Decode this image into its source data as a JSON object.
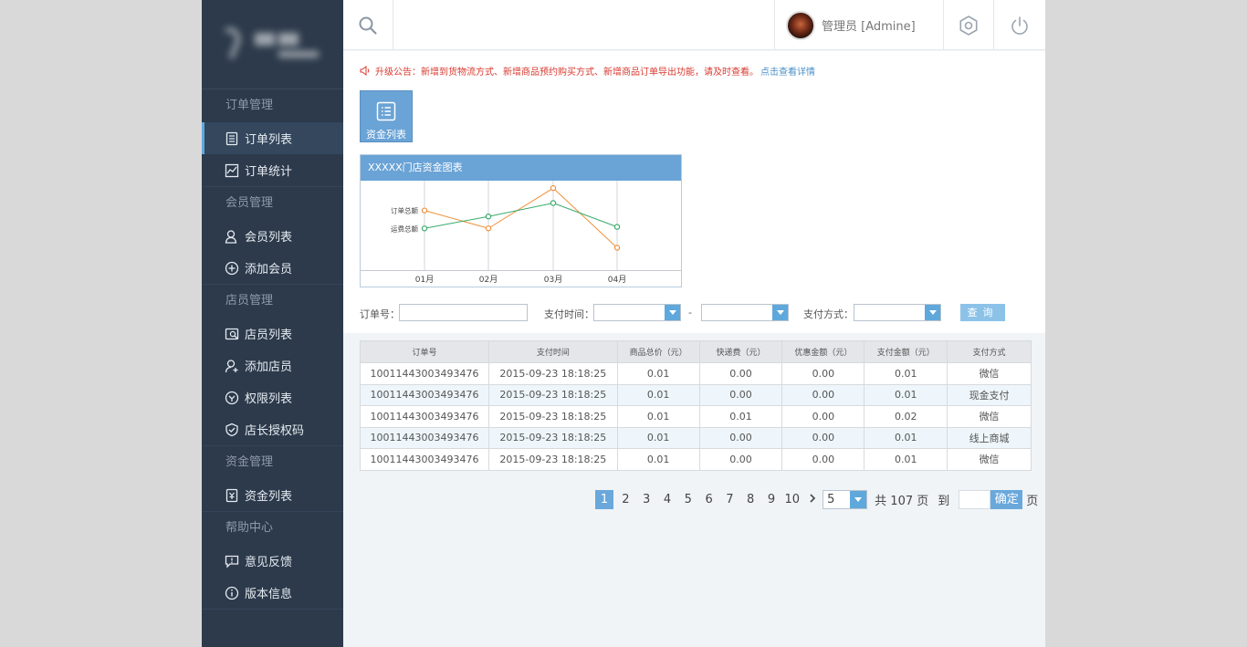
{
  "sidebar": {
    "sections": [
      {
        "title": "订单管理",
        "items": [
          "订单列表",
          "订单统计"
        ]
      },
      {
        "title": "会员管理",
        "items": [
          "会员列表",
          "添加会员"
        ]
      },
      {
        "title": "店员管理",
        "items": [
          "店员列表",
          "添加店员",
          "权限列表",
          "店长授权码"
        ]
      },
      {
        "title": "资金管理",
        "items": [
          "资金列表"
        ]
      },
      {
        "title": "帮助中心",
        "items": [
          "意见反馈",
          "版本信息"
        ]
      }
    ],
    "active_item": "订单列表"
  },
  "header": {
    "user": "管理员 [Admine]"
  },
  "notice": {
    "text": "升级公告：新增到货物流方式、新增商品预约购买方式、新增商品订单导出功能，请及时查看。",
    "link": "点击查看详情"
  },
  "tile": {
    "label": "资金列表"
  },
  "chart_data": {
    "type": "line",
    "title": "XXXXX门店资金图表",
    "categories": [
      "01月",
      "02月",
      "03月",
      "04月"
    ],
    "series": [
      {
        "name": "订单总额",
        "color": "#f0903a",
        "values": [
          40,
          28,
          55,
          15
        ]
      },
      {
        "name": "运费总额",
        "color": "#3aaa6a",
        "values": [
          28,
          36,
          45,
          29
        ]
      }
    ],
    "grid": true
  },
  "filters": {
    "order_no_label": "订单号：",
    "order_no_value": "",
    "pay_time_label": "支付时间：",
    "range_sep": "-",
    "pay_method_label": "支付方式：",
    "query_label": "查询"
  },
  "table": {
    "headers": [
      "订单号",
      "支付时间",
      "商品总价（元）",
      "快递费（元）",
      "优惠金额（元）",
      "支付金额（元）",
      "支付方式"
    ],
    "rows": [
      [
        "10011443003493476",
        "2015-09-23 18:18:25",
        "0.01",
        "0.00",
        "0.00",
        "0.01",
        "微信"
      ],
      [
        "10011443003493476",
        "2015-09-23 18:18:25",
        "0.01",
        "0.00",
        "0.00",
        "0.01",
        "现金支付"
      ],
      [
        "10011443003493476",
        "2015-09-23 18:18:25",
        "0.01",
        "0.01",
        "0.00",
        "0.02",
        "微信"
      ],
      [
        "10011443003493476",
        "2015-09-23 18:18:25",
        "0.01",
        "0.00",
        "0.00",
        "0.01",
        "线上商城"
      ],
      [
        "10011443003493476",
        "2015-09-23 18:18:25",
        "0.01",
        "0.00",
        "0.00",
        "0.01",
        "微信"
      ]
    ]
  },
  "pager": {
    "pages": [
      "1",
      "2",
      "3",
      "4",
      "5",
      "6",
      "7",
      "8",
      "9",
      "10"
    ],
    "current": "1",
    "page_size": "5",
    "total_text": "共 107 页",
    "goto_label": "到",
    "goto_value": "",
    "ok_label": "确定",
    "page_unit": "页"
  },
  "colors": {
    "sidebar": "#2c3a4b",
    "accent": "#6aa3d6",
    "alert": "#d9392f",
    "paid": "#c0262b"
  }
}
